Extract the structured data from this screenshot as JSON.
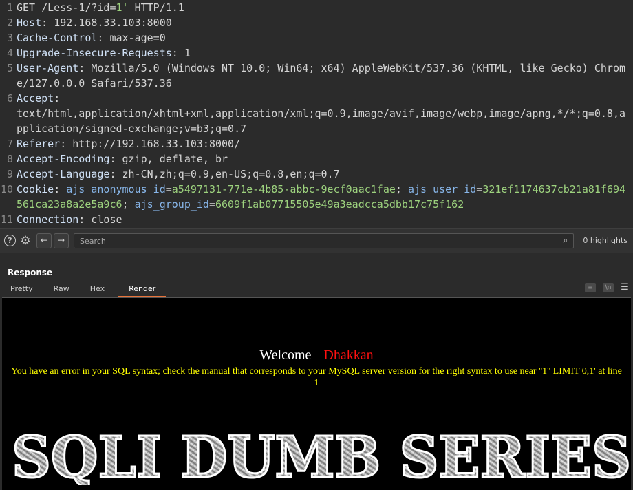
{
  "request": {
    "lines": [
      {
        "num": "1",
        "method_path": "GET /Less-1/?id=",
        "param_value": "1'",
        "protocol": " HTTP/1.1"
      },
      {
        "num": "2",
        "key": "Host",
        "value": "192.168.33.103:8000"
      },
      {
        "num": "3",
        "key": "Cache-Control",
        "value": "max-age=0"
      },
      {
        "num": "4",
        "key": "Upgrade-Insecure-Requests",
        "value": "1"
      },
      {
        "num": "5",
        "key": "User-Agent",
        "value": "Mozilla/5.0 (Windows NT 10.0; Win64; x64) AppleWebKit/537.36 (KHTML, like Gecko) Chrome/127.0.0.0 Safari/537.36"
      },
      {
        "num": "6",
        "key": "Accept",
        "value": "text/html,application/xhtml+xml,application/xml;q=0.9,image/avif,image/webp,image/apng,*/*;q=0.8,application/signed-exchange;v=b3;q=0.7"
      },
      {
        "num": "7",
        "key": "Referer",
        "value": "http://192.168.33.103:8000/"
      },
      {
        "num": "8",
        "key": "Accept-Encoding",
        "value": "gzip, deflate, br"
      },
      {
        "num": "9",
        "key": "Accept-Language",
        "value": "zh-CN,zh;q=0.9,en-US;q=0.8,en;q=0.7"
      },
      {
        "num": "10",
        "key": "Cookie",
        "cookies": [
          {
            "name": "ajs_anonymous_id",
            "value": "a5497131-771e-4b85-abbc-9ecf0aac1fae"
          },
          {
            "name": "ajs_user_id",
            "value": "321ef1174637cb21a81f694561ca23a8a2e5a9c6"
          },
          {
            "name": "ajs_group_id",
            "value": "6609f1ab07715505e49a3eadcca5dbb17c75f162"
          }
        ]
      },
      {
        "num": "11",
        "key": "Connection",
        "value": "close"
      }
    ]
  },
  "search": {
    "placeholder": "Search",
    "highlights": "0 highlights"
  },
  "response": {
    "title": "Response",
    "tabs": [
      "Pretty",
      "Raw",
      "Hex",
      "Render"
    ],
    "active_tab": "Render"
  },
  "render": {
    "welcome": "Welcome",
    "user": "Dhakkan",
    "error": "You have an error in your SQL syntax; check the manual that corresponds to your MySQL server version for the right syntax to use near ''1'' LIMIT 0,1' at line 1",
    "banner": "SQLI DUMB SERIES"
  },
  "colors": {
    "editor_bg": "#2b2b2b",
    "param_value": "#9dd27e",
    "cookie_name": "#87b5e8",
    "active_tab_underline": "#e8743b",
    "error_text": "#ffff00",
    "username": "#ff1010"
  },
  "icons": [
    "help-icon",
    "gear-icon",
    "arrow-left-icon",
    "arrow-right-icon",
    "search-icon",
    "menu-icon"
  ]
}
